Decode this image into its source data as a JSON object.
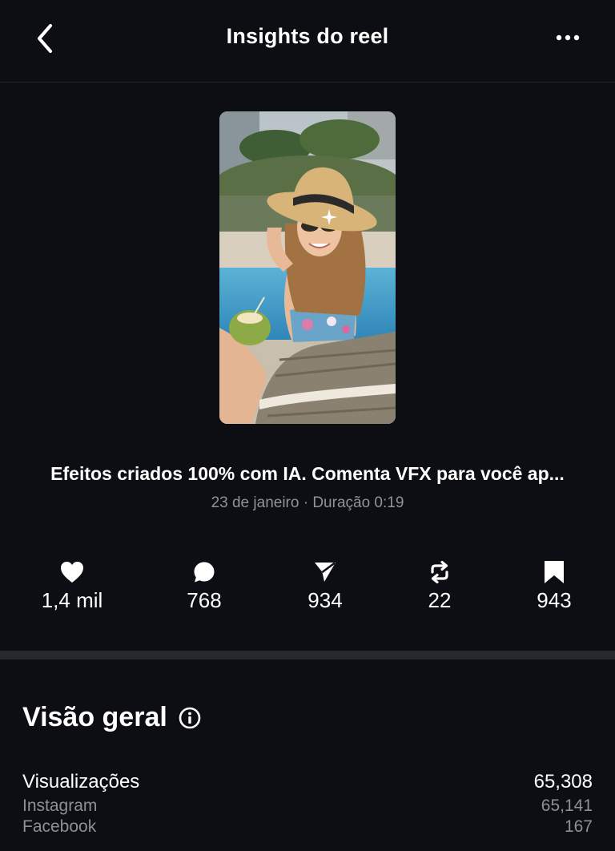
{
  "header": {
    "title": "Insights do reel",
    "back_icon": "chevron-left-icon",
    "more_icon": "more-horizontal-icon"
  },
  "reel": {
    "thumbnail": "woman-with-sun-hat-by-pool-image",
    "caption": "Efeitos criados 100% com IA. Comenta VFX para você ap...",
    "meta": "23 de janeiro · Duração 0:19"
  },
  "stats": [
    {
      "icon": "heart-icon",
      "value": "1,4 mil"
    },
    {
      "icon": "comment-icon",
      "value": "768"
    },
    {
      "icon": "send-icon",
      "value": "934"
    },
    {
      "icon": "repost-icon",
      "value": "22"
    },
    {
      "icon": "bookmark-icon",
      "value": "943"
    }
  ],
  "overview": {
    "title": "Visão geral",
    "info_icon": "info-icon",
    "views": {
      "label": "Visualizações",
      "value": "65,308"
    },
    "instagram": {
      "label": "Instagram",
      "value": "65,141"
    },
    "facebook": {
      "label": "Facebook",
      "value": "167"
    }
  },
  "colors": {
    "background": "#0c0e13",
    "text": "#ffffff",
    "muted": "#8e939c",
    "divider": "#25282f"
  }
}
